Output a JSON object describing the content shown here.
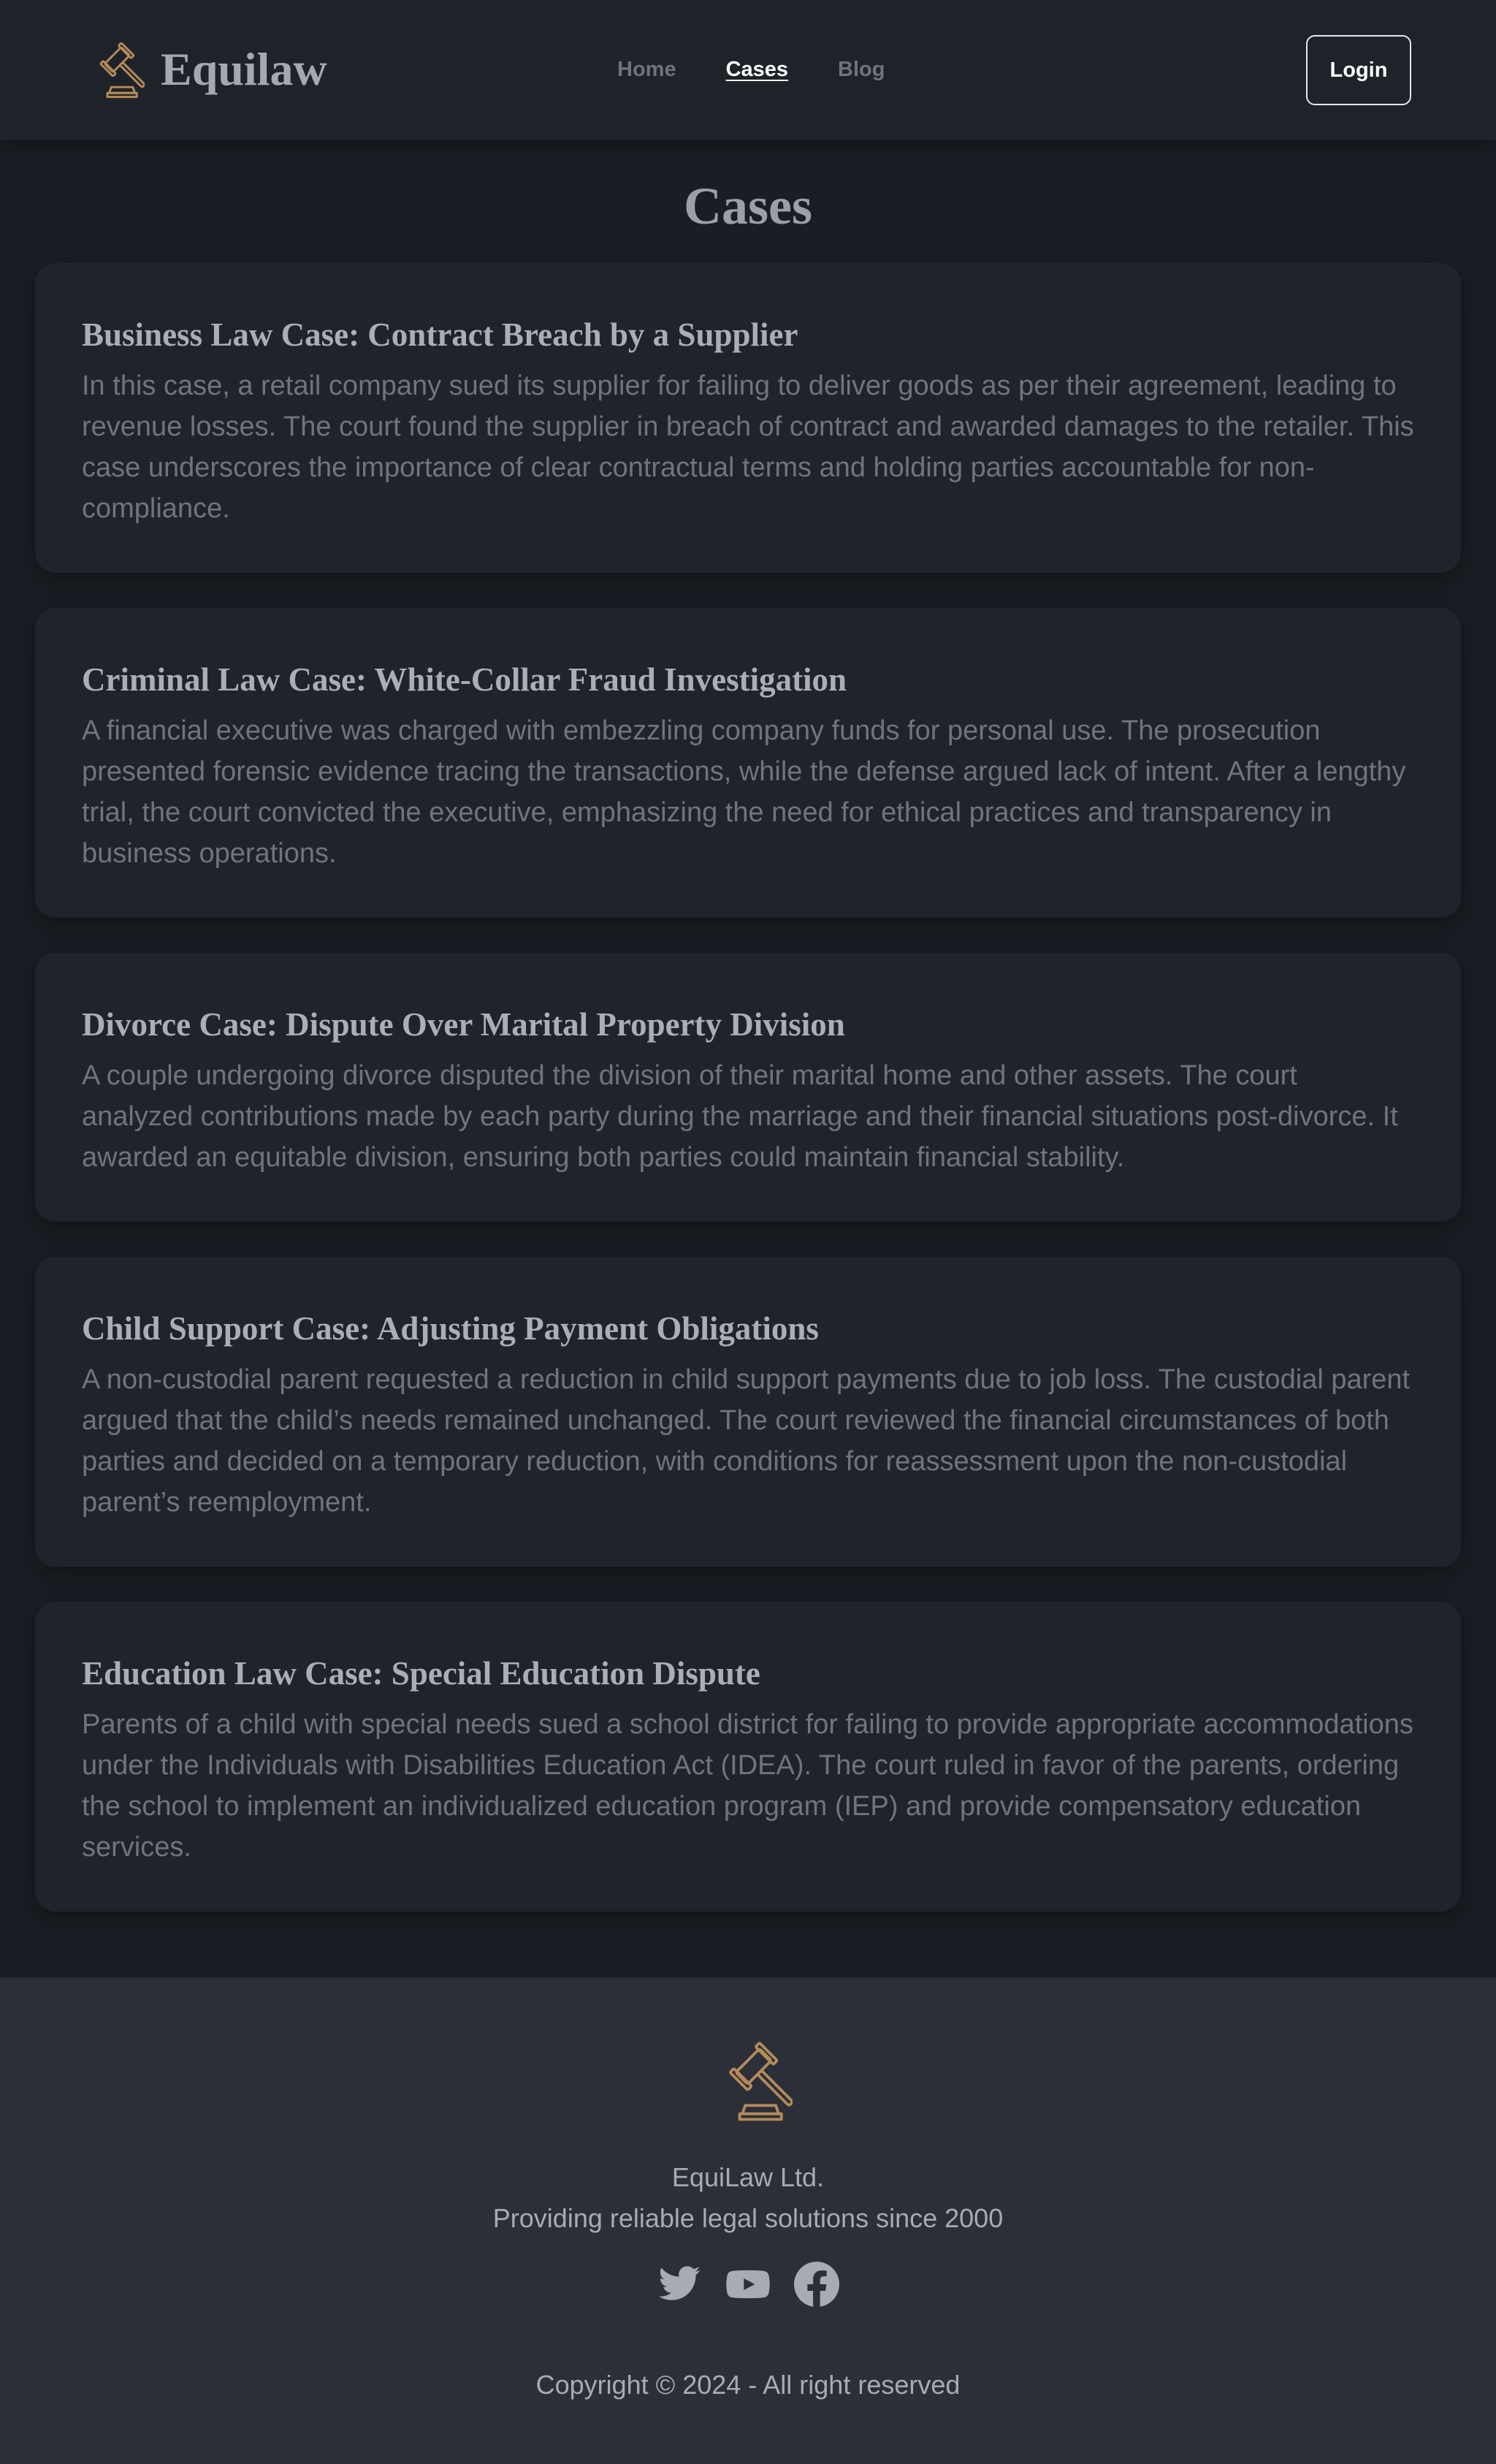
{
  "header": {
    "brand_name": "Equilaw",
    "logo_icon": "gavel-icon",
    "nav": [
      {
        "label": "Home",
        "active": false
      },
      {
        "label": "Cases",
        "active": true
      },
      {
        "label": "Blog",
        "active": false
      }
    ],
    "login_label": "Login"
  },
  "main": {
    "title": "Cases",
    "cases": [
      {
        "title": "Business Law Case: Contract Breach by a Supplier",
        "body": "In this case, a retail company sued its supplier for failing to deliver goods as per their agreement, leading to revenue losses. The court found the supplier in breach of contract and awarded damages to the retailer. This case underscores the importance of clear contractual terms and holding parties accountable for non-compliance."
      },
      {
        "title": "Criminal Law Case: White-Collar Fraud Investigation",
        "body": "A financial executive was charged with embezzling company funds for personal use. The prosecution presented forensic evidence tracing the transactions, while the defense argued lack of intent. After a lengthy trial, the court convicted the executive, emphasizing the need for ethical practices and transparency in business operations."
      },
      {
        "title": "Divorce Case: Dispute Over Marital Property Division",
        "body": "A couple undergoing divorce disputed the division of their marital home and other assets. The court analyzed contributions made by each party during the marriage and their financial situations post-divorce. It awarded an equitable division, ensuring both parties could maintain financial stability."
      },
      {
        "title": "Child Support Case: Adjusting Payment Obligations",
        "body": "A non-custodial parent requested a reduction in child support payments due to job loss. The custodial parent argued that the child’s needs remained unchanged. The court reviewed the financial circumstances of both parties and decided on a temporary reduction, with conditions for reassessment upon the non-custodial parent’s reemployment."
      },
      {
        "title": "Education Law Case: Special Education Dispute",
        "body": "Parents of a child with special needs sued a school district for failing to provide appropriate accommodations under the Individuals with Disabilities Education Act (IDEA). The court ruled in favor of the parents, ordering the school to implement an individualized education program (IEP) and provide compensatory education services."
      }
    ]
  },
  "footer": {
    "logo_icon": "gavel-icon",
    "company": "EquiLaw Ltd.",
    "tagline": "Providing reliable legal solutions since 2000",
    "social": [
      "twitter-icon",
      "youtube-icon",
      "facebook-icon"
    ],
    "copyright": "Copyright © 2024 - All right reserved"
  },
  "colors": {
    "background": "#1a1d23",
    "header": "#1e2229",
    "card": "#1f232a",
    "footer": "#2a2f38",
    "accent_gold": "#b58a5a"
  }
}
